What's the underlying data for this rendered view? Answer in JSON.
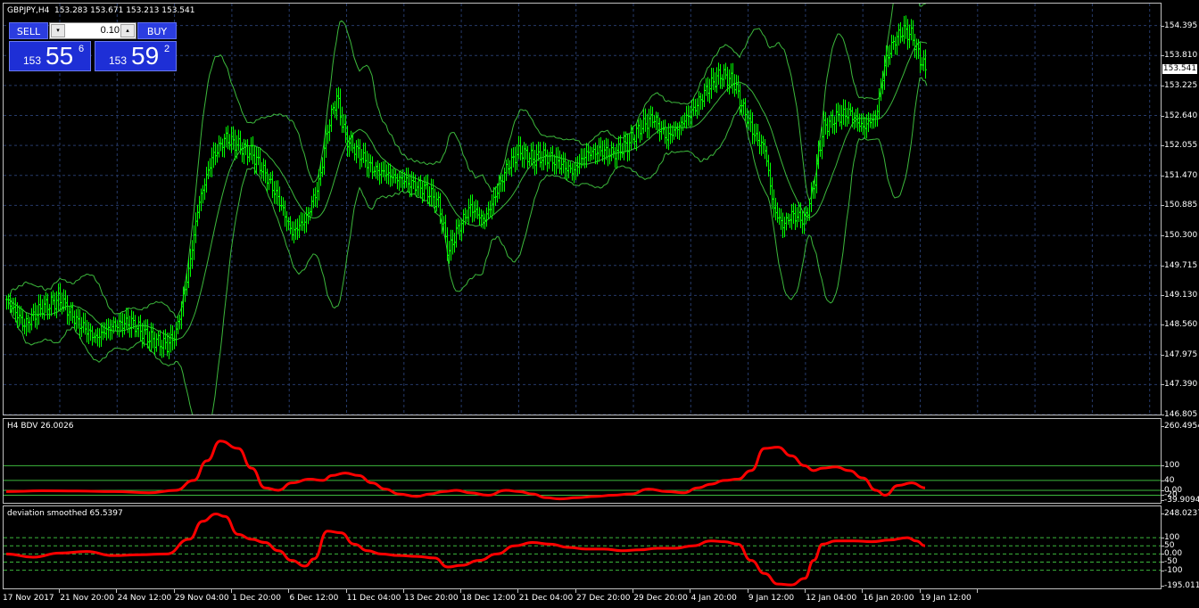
{
  "main": {
    "title": "GBPJPY,H4  153.283 153.671 153.213 153.541",
    "y_labels": [
      "154.395",
      "153.810",
      "153.225",
      "152.640",
      "152.055",
      "151.470",
      "150.885",
      "150.300",
      "149.715",
      "149.130",
      "148.560",
      "147.975",
      "147.390",
      "146.805"
    ],
    "current_price": "153.541",
    "colors": {
      "candles": "#00ff00",
      "bands": "#3cb83c",
      "grid": "#2f3f6f",
      "frame": "#c0c0c0"
    },
    "trade_panel": {
      "sell_label": "SELL",
      "buy_label": "BUY",
      "lot": "0.10",
      "sell_small": "153",
      "sell_big": "55",
      "sell_sup": "6",
      "buy_small": "153",
      "buy_big": "59",
      "buy_sup": "2",
      "spin_down": "▾",
      "spin_up": "▴"
    }
  },
  "indicator1": {
    "title": "H4 BDV 26.0026",
    "y_labels": [
      "260.4954",
      "100",
      "40",
      "0.00",
      "-20",
      "-39.9094"
    ],
    "color": "#ff0000"
  },
  "indicator2": {
    "title": "deviation smoothed 65.5397",
    "y_labels": [
      "248.0237",
      "100",
      "50",
      "0.00",
      "-50",
      "-100",
      "-195.0114"
    ],
    "color": "#ff0000"
  },
  "x_labels": [
    "17 Nov 2017",
    "21 Nov 20:00",
    "24 Nov 12:00",
    "29 Nov 04:00",
    "1 Dec 20:00",
    "6 Dec 12:00",
    "11 Dec 04:00",
    "13 Dec 20:00",
    "18 Dec 12:00",
    "21 Dec 04:00",
    "27 Dec 20:00",
    "29 Dec 20:00",
    "4 Jan 20:00",
    "9 Jan 12:00",
    "12 Jan 04:00",
    "16 Jan 20:00",
    "19 Jan 12:00"
  ],
  "chart_data": [
    {
      "type": "candlestick",
      "title": "GBPJPY,H4  153.283 153.671 153.213 153.541",
      "ylim": [
        146.805,
        154.98
      ],
      "y_ticks": [
        154.395,
        153.81,
        153.225,
        152.64,
        152.055,
        151.47,
        150.885,
        150.3,
        149.715,
        149.13,
        148.56,
        147.975,
        147.39,
        146.805
      ],
      "ohlc_last": {
        "open": 153.283,
        "high": 153.671,
        "low": 153.213,
        "close": 153.541
      },
      "close_path": [
        [
          0,
          149.05
        ],
        [
          20,
          148.55
        ],
        [
          40,
          148.9
        ],
        [
          60,
          149.05
        ],
        [
          80,
          148.6
        ],
        [
          100,
          148.3
        ],
        [
          120,
          148.55
        ],
        [
          140,
          148.6
        ],
        [
          160,
          148.3
        ],
        [
          180,
          148.15
        ],
        [
          190,
          148.4
        ],
        [
          205,
          149.7
        ],
        [
          215,
          150.9
        ],
        [
          230,
          151.8
        ],
        [
          245,
          152.2
        ],
        [
          260,
          152.05
        ],
        [
          275,
          151.9
        ],
        [
          290,
          151.5
        ],
        [
          305,
          151.0
        ],
        [
          320,
          150.35
        ],
        [
          335,
          150.6
        ],
        [
          350,
          151.3
        ],
        [
          360,
          152.4
        ],
        [
          370,
          153.0
        ],
        [
          380,
          152.2
        ],
        [
          395,
          151.9
        ],
        [
          410,
          151.6
        ],
        [
          425,
          151.5
        ],
        [
          440,
          151.4
        ],
        [
          455,
          151.3
        ],
        [
          470,
          151.2
        ],
        [
          485,
          150.9
        ],
        [
          495,
          149.95
        ],
        [
          505,
          150.4
        ],
        [
          520,
          150.85
        ],
        [
          535,
          150.6
        ],
        [
          545,
          150.95
        ],
        [
          560,
          151.6
        ],
        [
          575,
          151.95
        ],
        [
          590,
          151.8
        ],
        [
          605,
          151.85
        ],
        [
          620,
          151.7
        ],
        [
          635,
          151.55
        ],
        [
          650,
          151.9
        ],
        [
          665,
          151.95
        ],
        [
          680,
          151.9
        ],
        [
          695,
          152.05
        ],
        [
          710,
          152.4
        ],
        [
          725,
          152.6
        ],
        [
          740,
          152.2
        ],
        [
          755,
          152.45
        ],
        [
          770,
          152.75
        ],
        [
          785,
          153.15
        ],
        [
          800,
          153.45
        ],
        [
          815,
          153.3
        ],
        [
          825,
          152.8
        ],
        [
          840,
          152.2
        ],
        [
          850,
          152.0
        ],
        [
          860,
          150.8
        ],
        [
          870,
          150.5
        ],
        [
          880,
          150.7
        ],
        [
          895,
          150.6
        ],
        [
          905,
          151.3
        ],
        [
          915,
          152.4
        ],
        [
          930,
          152.6
        ],
        [
          945,
          152.7
        ],
        [
          960,
          152.4
        ],
        [
          975,
          152.65
        ],
        [
          985,
          153.7
        ],
        [
          995,
          154.1
        ],
        [
          1005,
          154.3
        ],
        [
          1015,
          154.2
        ],
        [
          1025,
          153.7
        ],
        [
          1030,
          153.541
        ]
      ],
      "series": [
        {
          "name": "",
          "style": "bands_upper"
        },
        {
          "name": "",
          "style": "bands_middle"
        },
        {
          "name": "",
          "style": "bands_lower"
        }
      ],
      "grid": true
    },
    {
      "type": "line",
      "title": "H4 BDV 26.0026",
      "ylim": [
        -39.9094,
        260.4954
      ],
      "levels": [
        100,
        40,
        0,
        -20
      ],
      "x": [
        0,
        40,
        80,
        120,
        160,
        190,
        210,
        225,
        240,
        260,
        275,
        290,
        305,
        320,
        340,
        355,
        365,
        380,
        395,
        410,
        425,
        440,
        460,
        475,
        490,
        505,
        520,
        540,
        560,
        575,
        590,
        605,
        620,
        640,
        660,
        680,
        700,
        720,
        740,
        760,
        775,
        790,
        805,
        820,
        835,
        850,
        865,
        880,
        895,
        905,
        915,
        930,
        945,
        960,
        975,
        985,
        1000,
        1015,
        1030
      ],
      "values": [
        -5,
        -2,
        -3,
        -5,
        -10,
        0,
        40,
        120,
        200,
        170,
        90,
        10,
        0,
        30,
        45,
        40,
        60,
        70,
        60,
        30,
        5,
        -15,
        -25,
        -15,
        -5,
        0,
        -10,
        -20,
        0,
        -5,
        -15,
        -30,
        -35,
        -30,
        -25,
        -20,
        -15,
        5,
        -5,
        -10,
        10,
        25,
        40,
        45,
        80,
        170,
        175,
        140,
        100,
        80,
        90,
        95,
        80,
        50,
        0,
        -20,
        20,
        30,
        10
      ]
    },
    {
      "type": "line",
      "title": "deviation smoothed 65.5397",
      "ylim": [
        -195.0114,
        248.0237
      ],
      "levels": [
        100,
        50,
        0,
        -50,
        -100
      ],
      "x": [
        0,
        30,
        60,
        90,
        120,
        150,
        180,
        205,
        220,
        235,
        245,
        260,
        275,
        290,
        305,
        320,
        335,
        345,
        360,
        375,
        390,
        405,
        420,
        440,
        460,
        480,
        495,
        510,
        530,
        550,
        570,
        590,
        610,
        630,
        650,
        670,
        690,
        710,
        730,
        750,
        770,
        790,
        805,
        820,
        835,
        850,
        865,
        880,
        895,
        905,
        915,
        930,
        950,
        970,
        990,
        1010,
        1020,
        1030
      ],
      "values": [
        0,
        -20,
        5,
        15,
        -10,
        -5,
        0,
        90,
        200,
        245,
        230,
        120,
        90,
        70,
        20,
        -40,
        -75,
        -30,
        140,
        130,
        60,
        20,
        0,
        -10,
        -15,
        -25,
        -80,
        -70,
        -40,
        0,
        50,
        70,
        60,
        40,
        30,
        30,
        20,
        25,
        35,
        35,
        50,
        80,
        75,
        60,
        -40,
        -120,
        -185,
        -190,
        -150,
        -40,
        60,
        80,
        80,
        75,
        85,
        100,
        80,
        50
      ]
    }
  ]
}
